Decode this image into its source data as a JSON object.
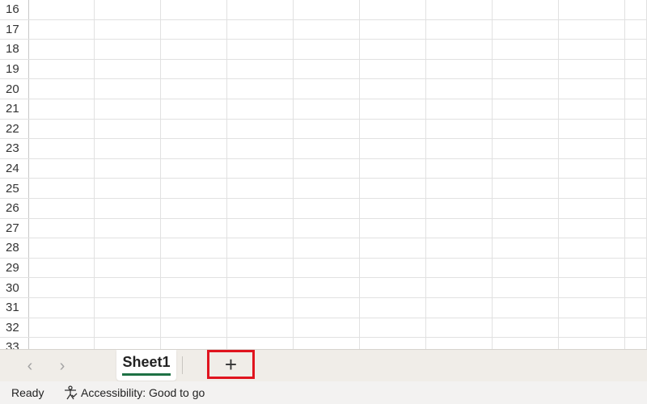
{
  "grid": {
    "row_numbers": [
      "16",
      "17",
      "18",
      "19",
      "20",
      "21",
      "22",
      "23",
      "24",
      "25",
      "26",
      "27",
      "28",
      "29",
      "30",
      "31",
      "32",
      "33"
    ]
  },
  "sheet_tabs": {
    "prev_icon": "chevron-left-icon",
    "next_icon": "chevron-right-icon",
    "active_sheet": "Sheet1",
    "add_sheet_label": "+"
  },
  "status_bar": {
    "ready": "Ready",
    "accessibility": "Accessibility: Good to go"
  },
  "colors": {
    "active_tab_underline": "#1e7145",
    "highlight_box": "#e0141e"
  }
}
